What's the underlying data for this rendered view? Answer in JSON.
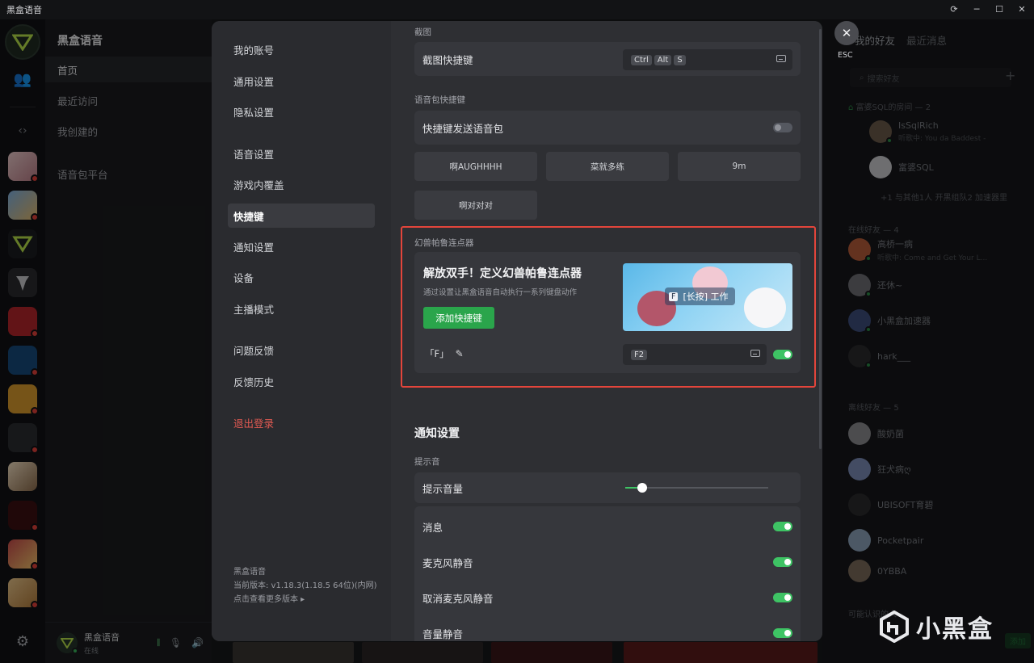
{
  "window": {
    "title": "黑盒语音"
  },
  "sidebar2": {
    "title": "黑盒语音",
    "items": [
      "首页",
      "最近访问",
      "我创建的",
      "语音包平台"
    ],
    "user": {
      "name": "黑盒语音",
      "status": "在线"
    }
  },
  "friends": {
    "tabs": [
      "我的好友",
      "最近消息"
    ],
    "search_placeholder": "搜索好友",
    "groups": [
      {
        "label": "富婆SQL的房间 — 2"
      },
      {
        "label": "在线好友 — 4"
      },
      {
        "label": "离线好友 — 5"
      },
      {
        "label": "可能认识的人"
      }
    ],
    "room_members": [
      {
        "name": "IsSqlRich",
        "sub": "听歌中: You da Baddest -"
      },
      {
        "name": "富婆SQL",
        "sub": ""
      }
    ],
    "room_more": "+1  与其他1人 开黑组队2 加速器里",
    "online": [
      {
        "name": "高桥一病",
        "sub": "听歌中: Come and Get Your L..."
      },
      {
        "name": "还休~",
        "sub": ""
      },
      {
        "name": "小黑盒加速器",
        "sub": ""
      },
      {
        "name": "hark___",
        "sub": ""
      }
    ],
    "offline": [
      {
        "name": "酸奶菌",
        "sub": ""
      },
      {
        "name": "狂犬病ღ",
        "sub": ""
      },
      {
        "name": "UBISOFT育碧",
        "sub": ""
      },
      {
        "name": "Pocketpair",
        "sub": ""
      },
      {
        "name": "0YBBA",
        "sub": ""
      }
    ],
    "add_label": "添加"
  },
  "modal": {
    "nav": {
      "items": [
        "我的账号",
        "通用设置",
        "隐私设置",
        "语音设置",
        "游戏内覆盖",
        "快捷键",
        "通知设置",
        "设备",
        "主播模式",
        "问题反馈",
        "反馈历史"
      ],
      "active": "快捷键",
      "logout": "退出登录",
      "app_name": "黑盒语音",
      "version": "当前版本: v1.18.3(1.18.5 64位)(内网)",
      "more_versions": "点击查看更多版本 ▸"
    },
    "screenshot": {
      "section": "截图",
      "label": "截图快捷键",
      "keys": [
        "Ctrl",
        "Alt",
        "S"
      ]
    },
    "voicepack": {
      "section": "语音包快捷键",
      "label": "快捷键发送语音包",
      "enabled": false,
      "packs": [
        "啊AUGHHHH",
        "菜就多练",
        "9m",
        "啊对对对"
      ]
    },
    "macro": {
      "section": "幻兽帕鲁连点器",
      "headline": "解放双手！定义幻兽帕鲁连点器",
      "desc": "通过设置让黑盒语音自动执行一系列键盘动作",
      "add_button": "添加快捷键",
      "art_key": "F",
      "art_text": "[长按] 工作",
      "key_name": "「F」",
      "trigger_key": "F2",
      "enabled": true
    },
    "notifications": {
      "title": "通知设置",
      "sound_section": "提示音",
      "volume_label": "提示音量",
      "volume_level": 0.12,
      "toggles": [
        {
          "label": "消息",
          "on": true
        },
        {
          "label": "麦克风静音",
          "on": true
        },
        {
          "label": "取消麦克风静音",
          "on": true
        },
        {
          "label": "音量静音",
          "on": true
        }
      ]
    }
  },
  "close": {
    "esc_label": "ESC"
  },
  "watermark": {
    "text": "小黑盒"
  },
  "colors": {
    "accent": "#3ec364",
    "button": "#2aa54b",
    "highlight": "#e3453b",
    "danger": "#e25a52"
  }
}
